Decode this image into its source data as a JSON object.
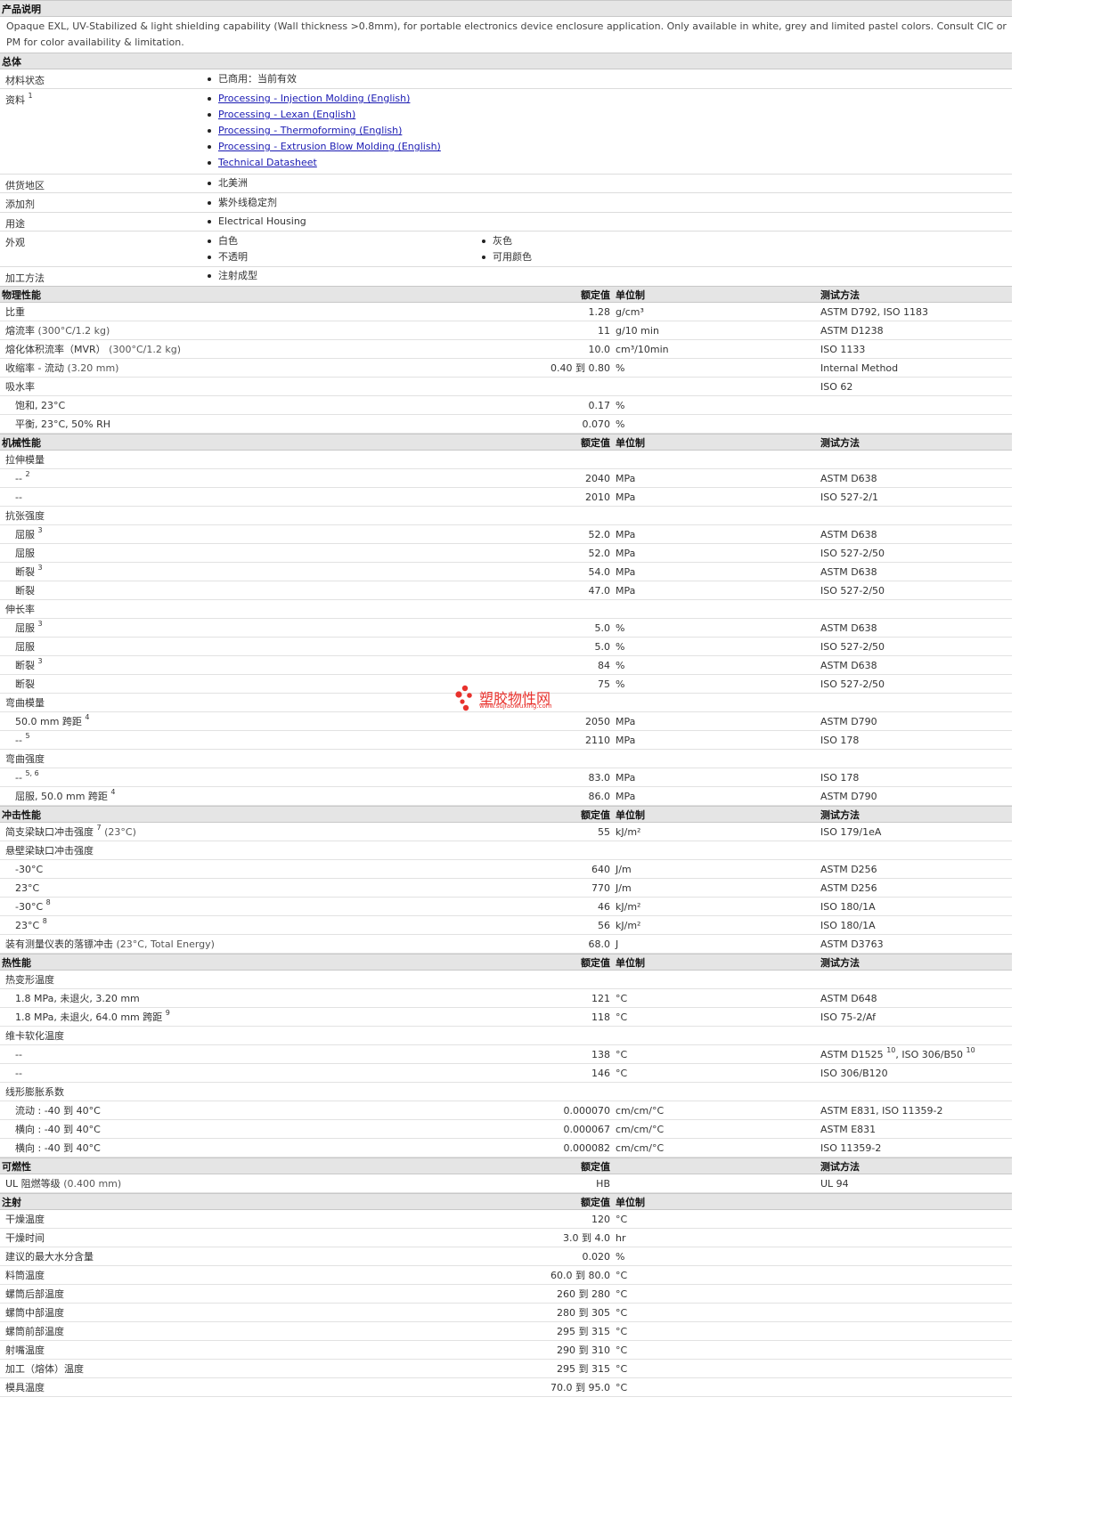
{
  "description": {
    "header": "产品说明",
    "text": "Opaque EXL, UV-Stabilized & light shielding capability (Wall thickness >0.8mm), for portable electronics device enclosure application. Only available in white, grey and limited pastel colors. Consult CIC or PM for color availability & limitation."
  },
  "general": {
    "header": "总体",
    "status_label": "材料状态",
    "status_value": "已商用：当前有效",
    "docs_label": "资料",
    "docs_sup": "1",
    "docs": [
      "Processing - Injection Molding (English)",
      "Processing - Lexan (English)",
      "Processing - Thermoforming (English)",
      "Processing - Extrusion Blow Molding (English)",
      "Technical Datasheet"
    ],
    "region_label": "供货地区",
    "region_value": "北美洲",
    "additive_label": "添加剂",
    "additive_value": "紫外线稳定剂",
    "uses_label": "用途",
    "uses_value": "Electrical Housing",
    "appearance_label": "外观",
    "appearance_col1": [
      "白色",
      "不透明"
    ],
    "appearance_col2": [
      "灰色",
      "可用颜色"
    ],
    "method_label": "加工方法",
    "method_value": "注射成型"
  },
  "column_headers": {
    "value": "额定值",
    "unit": "单位制",
    "method": "测试方法"
  },
  "sections": [
    {
      "title": "物理性能",
      "show_unit": true,
      "rows": [
        {
          "label": "比重",
          "value": "1.28",
          "unit": "g/cm³",
          "method": "ASTM D792, ISO 1183"
        },
        {
          "label": "熔流率",
          "cond": "(300°C/1.2 kg)",
          "value": "11",
          "unit": "g/10 min",
          "method": "ASTM D1238"
        },
        {
          "label": "熔化体积流率（MVR）",
          "cond": "(300°C/1.2 kg)",
          "value": "10.0",
          "unit": "cm³/10min",
          "method": "ISO 1133"
        },
        {
          "label": "收缩率 - 流动",
          "cond": "(3.20 mm)",
          "value": "0.40 到  0.80",
          "unit": "%",
          "method": "Internal Method"
        },
        {
          "label": "吸水率",
          "method": "ISO 62"
        },
        {
          "label": "饱和, 23°C",
          "indent": true,
          "value": "0.17",
          "unit": "%"
        },
        {
          "label": "平衡, 23°C, 50% RH",
          "indent": true,
          "value": "0.070",
          "unit": "%"
        }
      ]
    },
    {
      "title": "机械性能",
      "show_unit": true,
      "rows": [
        {
          "label": "拉伸模量"
        },
        {
          "label": "--",
          "sup": "2",
          "indent": true,
          "value": "2040",
          "unit": "MPa",
          "method": "ASTM D638"
        },
        {
          "label": "--",
          "indent": true,
          "value": "2010",
          "unit": "MPa",
          "method": "ISO 527-2/1"
        },
        {
          "label": "抗张强度"
        },
        {
          "label": "屈服",
          "sup": "3",
          "indent": true,
          "value": "52.0",
          "unit": "MPa",
          "method": "ASTM D638"
        },
        {
          "label": "屈服",
          "indent": true,
          "value": "52.0",
          "unit": "MPa",
          "method": "ISO 527-2/50"
        },
        {
          "label": "断裂",
          "sup": "3",
          "indent": true,
          "value": "54.0",
          "unit": "MPa",
          "method": "ASTM D638"
        },
        {
          "label": "断裂",
          "indent": true,
          "value": "47.0",
          "unit": "MPa",
          "method": "ISO 527-2/50"
        },
        {
          "label": "伸长率"
        },
        {
          "label": "屈服",
          "sup": "3",
          "indent": true,
          "value": "5.0",
          "unit": "%",
          "method": "ASTM D638"
        },
        {
          "label": "屈服",
          "indent": true,
          "value": "5.0",
          "unit": "%",
          "method": "ISO 527-2/50"
        },
        {
          "label": "断裂",
          "sup": "3",
          "indent": true,
          "value": "84",
          "unit": "%",
          "method": "ASTM D638"
        },
        {
          "label": "断裂",
          "indent": true,
          "value": "75",
          "unit": "%",
          "method": "ISO 527-2/50"
        },
        {
          "label": "弯曲模量"
        },
        {
          "label": "50.0 mm 跨距",
          "sup": "4",
          "indent": true,
          "value": "2050",
          "unit": "MPa",
          "method": "ASTM D790"
        },
        {
          "label": "--",
          "sup": "5",
          "indent": true,
          "value": "2110",
          "unit": "MPa",
          "method": "ISO 178"
        },
        {
          "label": "弯曲强度"
        },
        {
          "label": "--",
          "sup": "5, 6",
          "indent": true,
          "value": "83.0",
          "unit": "MPa",
          "method": "ISO 178"
        },
        {
          "label": "屈服, 50.0 mm 跨距",
          "sup": "4",
          "indent": true,
          "value": "86.0",
          "unit": "MPa",
          "method": "ASTM D790"
        }
      ]
    },
    {
      "title": "冲击性能",
      "show_unit": true,
      "rows": [
        {
          "label": "简支梁缺口冲击强度",
          "sup": "7",
          "cond": "(23°C)",
          "value": "55",
          "unit": "kJ/m²",
          "method": "ISO 179/1eA"
        },
        {
          "label": "悬壁梁缺口冲击强度"
        },
        {
          "label": "-30°C",
          "indent": true,
          "value": "640",
          "unit": "J/m",
          "method": "ASTM D256"
        },
        {
          "label": "23°C",
          "indent": true,
          "value": "770",
          "unit": "J/m",
          "method": "ASTM D256"
        },
        {
          "label": "-30°C",
          "sup": "8",
          "indent": true,
          "value": "46",
          "unit": "kJ/m²",
          "method": "ISO 180/1A"
        },
        {
          "label": "23°C",
          "sup": "8",
          "indent": true,
          "value": "56",
          "unit": "kJ/m²",
          "method": "ISO 180/1A"
        },
        {
          "label": "装有测量仪表的落镖冲击",
          "cond": "(23°C, Total Energy)",
          "value": "68.0",
          "unit": "J",
          "method": "ASTM D3763"
        }
      ]
    },
    {
      "title": "热性能",
      "show_unit": true,
      "rows": [
        {
          "label": "热变形温度"
        },
        {
          "label": "1.8 MPa, 未退火, 3.20 mm",
          "indent": true,
          "value": "121",
          "unit": "°C",
          "method": "ASTM D648"
        },
        {
          "label": "1.8 MPa, 未退火, 64.0 mm 跨距",
          "sup": "9",
          "indent": true,
          "value": "118",
          "unit": "°C",
          "method": "ISO 75-2/Af"
        },
        {
          "label": "维卡软化温度"
        },
        {
          "label": "--",
          "indent": true,
          "value": "138",
          "unit": "°C",
          "method": "ASTM D1525",
          "method_sup": "10",
          "method2": ", ISO 306/B50",
          "method2_sup": "10"
        },
        {
          "label": "--",
          "indent": true,
          "value": "146",
          "unit": "°C",
          "method": "ISO 306/B120"
        },
        {
          "label": "线形膨胀系数"
        },
        {
          "label": "流动 : -40 到  40°C",
          "indent": true,
          "value": "0.000070",
          "unit": "cm/cm/°C",
          "method": "ASTM E831, ISO 11359-2"
        },
        {
          "label": "横向 : -40 到  40°C",
          "indent": true,
          "value": "0.000067",
          "unit": "cm/cm/°C",
          "method": "ASTM E831"
        },
        {
          "label": "横向 : -40 到  40°C",
          "indent": true,
          "value": "0.000082",
          "unit": "cm/cm/°C",
          "method": "ISO 11359-2"
        }
      ]
    },
    {
      "title": "可燃性",
      "show_unit": false,
      "rows": [
        {
          "label": "UL 阻燃等级",
          "cond": "(0.400 mm)",
          "value": "HB",
          "method": "UL 94"
        }
      ]
    },
    {
      "title": "注射",
      "show_unit": true,
      "show_method": false,
      "rows": [
        {
          "label": "干燥温度",
          "value": "120",
          "unit": "°C"
        },
        {
          "label": "干燥时间",
          "value": "3.0 到  4.0",
          "unit": "hr"
        },
        {
          "label": "建议的最大水分含量",
          "value": "0.020",
          "unit": "%"
        },
        {
          "label": "料筒温度",
          "value": "60.0 到  80.0",
          "unit": "°C"
        },
        {
          "label": "螺筒后部温度",
          "value": "260 到  280",
          "unit": "°C"
        },
        {
          "label": "螺筒中部温度",
          "value": "280 到  305",
          "unit": "°C"
        },
        {
          "label": "螺筒前部温度",
          "value": "295 到  315",
          "unit": "°C"
        },
        {
          "label": "射嘴温度",
          "value": "290 到  310",
          "unit": "°C"
        },
        {
          "label": "加工（熔体）温度",
          "value": "295 到  315",
          "unit": "°C"
        },
        {
          "label": "模具温度",
          "value": "70.0 到  95.0",
          "unit": "°C"
        }
      ]
    }
  ],
  "watermark": {
    "title": "塑胶物性网",
    "url": "www.sujiaowuxing.com"
  },
  "colors": {
    "section_bg": "#e5e5e5",
    "link": "#1b1bb3",
    "watermark": "#e8312c"
  }
}
